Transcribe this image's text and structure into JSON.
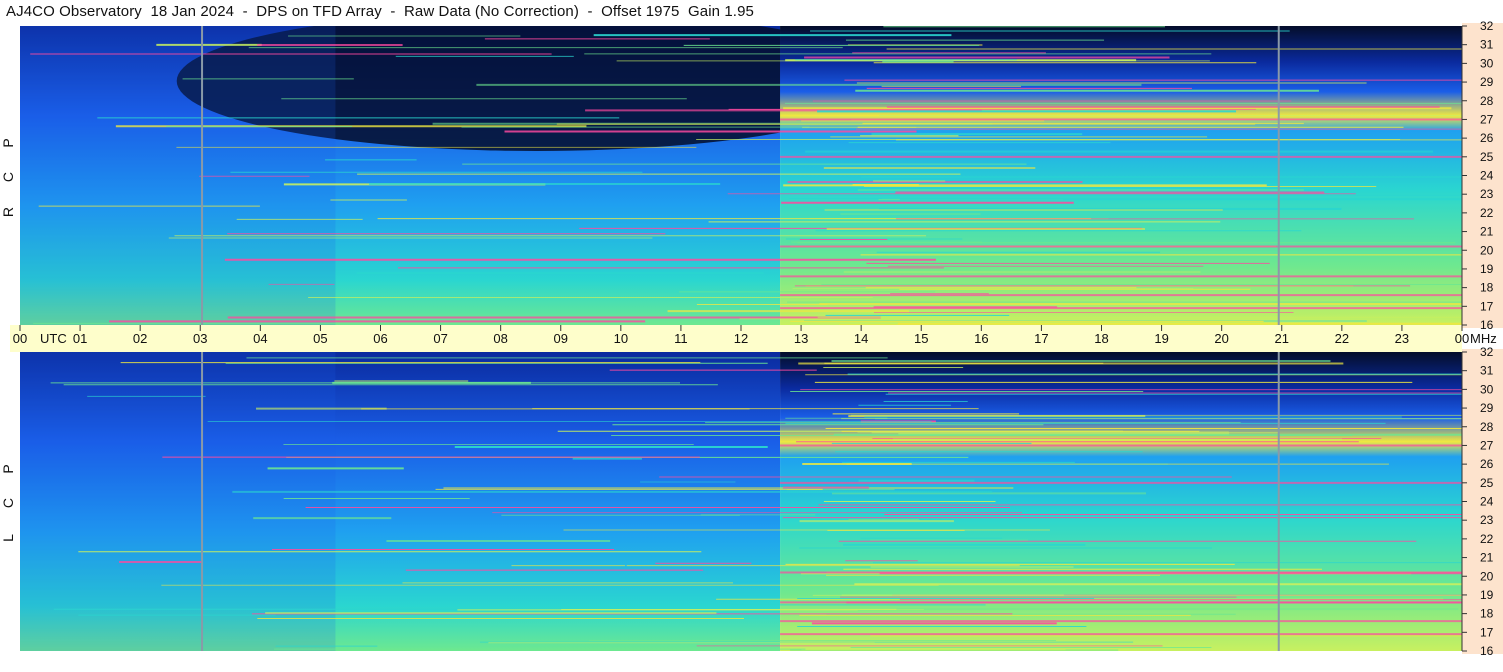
{
  "title": "AJ4CO Observatory  18 Jan 2024  -  DPS on TFD Array  -  Raw Data (No Correction)  -  Offset 1975  Gain 1.95",
  "colors": {
    "background": "#ffffff",
    "freq_axis_bg": "#fde3cd",
    "time_axis_bg": "#fefecb",
    "colormap": [
      "#040d2a",
      "#0a2a9e",
      "#1a5ee8",
      "#1fa0f0",
      "#2ad6d0",
      "#6de890",
      "#c8f060",
      "#f0e840",
      "#ff4aa0"
    ]
  },
  "chart_data": {
    "type": "heatmap",
    "x_unit": "UTC",
    "y_unit": "MHz",
    "x_ticks": [
      "00",
      "01",
      "02",
      "03",
      "04",
      "05",
      "06",
      "07",
      "08",
      "09",
      "10",
      "11",
      "12",
      "13",
      "14",
      "15",
      "16",
      "17",
      "18",
      "19",
      "20",
      "21",
      "22",
      "23",
      "00"
    ],
    "y_ticks": [
      32,
      31,
      30,
      29,
      28,
      27,
      26,
      25,
      24,
      23,
      22,
      21,
      20,
      19,
      18,
      17,
      16
    ],
    "xlim": [
      0,
      24
    ],
    "ylim": [
      16,
      32
    ],
    "panels": [
      {
        "label": "R C P",
        "letters": [
          "R",
          "C",
          "P"
        ]
      },
      {
        "label": "L C P",
        "letters": [
          "L",
          "C",
          "P"
        ]
      }
    ],
    "dark_onset_utc": 12.65,
    "vertical_markers_utc": [
      3.03,
      20.95
    ]
  }
}
